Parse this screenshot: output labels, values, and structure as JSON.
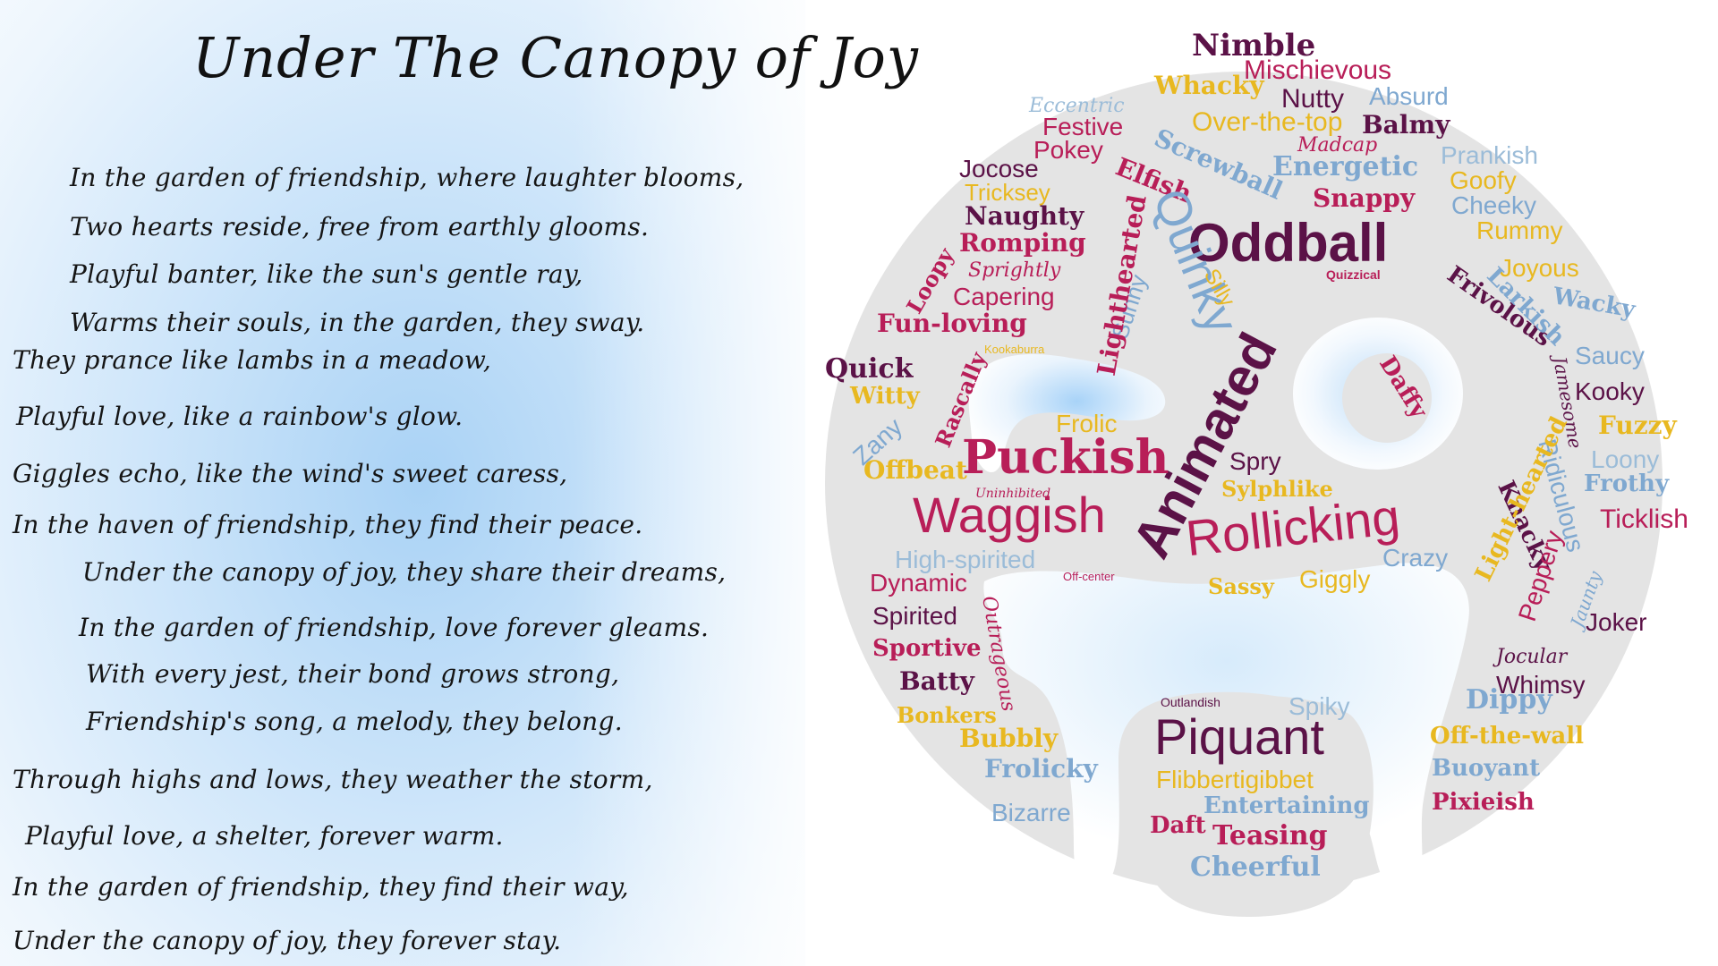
{
  "poem": {
    "title": "Under The Canopy of Joy",
    "lines": [
      "In the garden of friendship, where laughter blooms,",
      "Two hearts reside, free from earthly glooms.",
      "Playful banter, like the sun's gentle ray,",
      "Warms their souls, in the garden, they sway.",
      "They prance like lambs in a meadow,",
      "Playful love, like a rainbow's glow.",
      "Giggles echo, like the wind's sweet caress,",
      "In the haven of friendship, they find their peace.",
      "Under the canopy of joy, they share their dreams,",
      "In the garden of friendship, love forever gleams.",
      "With every jest, their bond grows strong,",
      "Friendship's song, a melody, they belong.",
      "Through highs and lows, they weather the storm,",
      "Playful love, a shelter, forever warm.",
      "In the garden of friendship, they find their way,",
      "Under the canopy of joy, they forever stay."
    ]
  },
  "colors": {
    "maroon": "#5b1247",
    "crimson": "#b81e58",
    "gold": "#e8b820",
    "lightblue": "#7fa8d0",
    "mask": "#e4e4e4"
  },
  "wordcloud": {
    "words": [
      "Nimble",
      "Mischievous",
      "Whacky",
      "Nutty",
      "Absurd",
      "Eccentric",
      "Over-the-top",
      "Balmy",
      "Festive",
      "Screwball",
      "Madcap",
      "Pokey",
      "Prankish",
      "Energetic",
      "Jocose",
      "Elfish",
      "Goofy",
      "Snappy",
      "Tricksey",
      "Cheeky",
      "Naughty",
      "Oddball",
      "Rummy",
      "Romping",
      "Quinky",
      "Joyous",
      "Sprightly",
      "Silly",
      "Quizzical",
      "Loopy",
      "Frivolous",
      "Capering",
      "Larkish",
      "Wacky",
      "Fun-loving",
      "Sunny",
      "Lighthearted",
      "Kookaburra",
      "Saucy",
      "Quick",
      "Daffy",
      "Witty",
      "Kooky",
      "Rascally",
      "Animated",
      "Zany",
      "Frolic",
      "Jamesome",
      "Fuzzy",
      "Puckish",
      "Loony",
      "Offbeat",
      "Spry",
      "Frothy",
      "Uninhibited",
      "Sylphlike",
      "Ridiculous",
      "Waggish",
      "Knacky",
      "Ticklish",
      "Rollicking",
      "Light-hearted",
      "High-spirited",
      "Crazy",
      "Peppery",
      "Dynamic",
      "Off-center",
      "Sassy",
      "Giggly",
      "Jaunty",
      "Spirited",
      "Outrageous",
      "Joker",
      "Sportive",
      "Jocular",
      "Whimsy",
      "Batty",
      "Dippy",
      "Outlandish",
      "Spiky",
      "Bonkers",
      "Piquant",
      "Off-the-wall",
      "Bubbly",
      "Buoyant",
      "Flibbertigibbet",
      "Frolicky",
      "Pixieish",
      "Entertaining",
      "Bizarre",
      "Daft",
      "Teasing",
      "Cheerful"
    ]
  }
}
